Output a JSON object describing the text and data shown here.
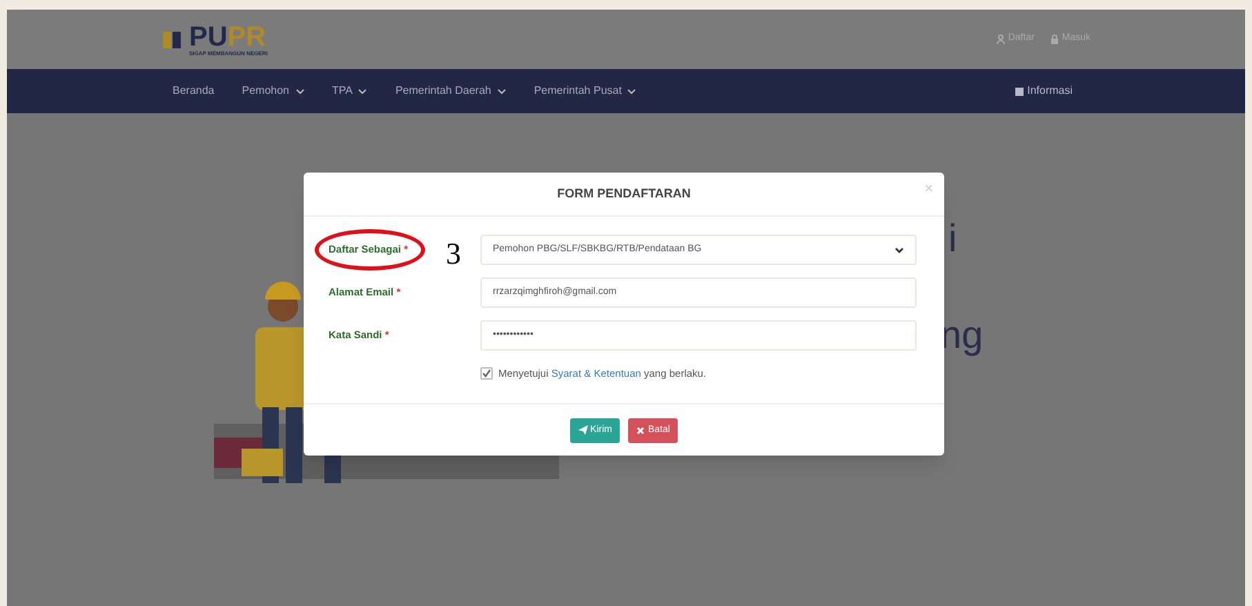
{
  "header": {
    "logo": {
      "parts": [
        "PU",
        "PR"
      ],
      "tagline": "SIGAP MEMBANGUN NEGERI"
    },
    "links": [
      {
        "kind": "register",
        "label": "Daftar"
      },
      {
        "kind": "login",
        "label": "Masuk"
      }
    ]
  },
  "navbar": {
    "items": [
      {
        "label": "Beranda",
        "dropdown": false
      },
      {
        "label": "Pemohon",
        "dropdown": true
      },
      {
        "label": "TPA",
        "dropdown": true
      },
      {
        "label": "Pemerintah Daerah",
        "dropdown": true
      },
      {
        "label": "Pemerintah Pusat",
        "dropdown": true
      }
    ],
    "right": {
      "label": "Informasi"
    }
  },
  "background_text": [
    "i",
    "ng"
  ],
  "modal": {
    "title": "FORM PENDAFTARAN",
    "close": "×",
    "fields": [
      {
        "kind": "select",
        "label": "Daftar Sebagai",
        "required_mark": "*",
        "value": "Pemohon PBG/SLF/SBKBG/RTB/Pendataan BG",
        "circled": true
      },
      {
        "kind": "text",
        "label": "Alamat Email",
        "required_mark": "*",
        "value": "rrzarzqimghfiroh@gmail.com",
        "circled": false
      },
      {
        "kind": "password",
        "label": "Kata Sandi",
        "required_mark": "*",
        "value": "••••••••••••",
        "circled": false
      }
    ],
    "agreement": {
      "checked": true,
      "before": "Menyetujui",
      "link": "Syarat & Ketentuan",
      "after": "yang berlaku."
    },
    "buttons": [
      {
        "kind": "submit",
        "label": "Kirim"
      },
      {
        "kind": "cancel",
        "label": "Batal"
      }
    ]
  },
  "annotation": {
    "number": "3"
  }
}
